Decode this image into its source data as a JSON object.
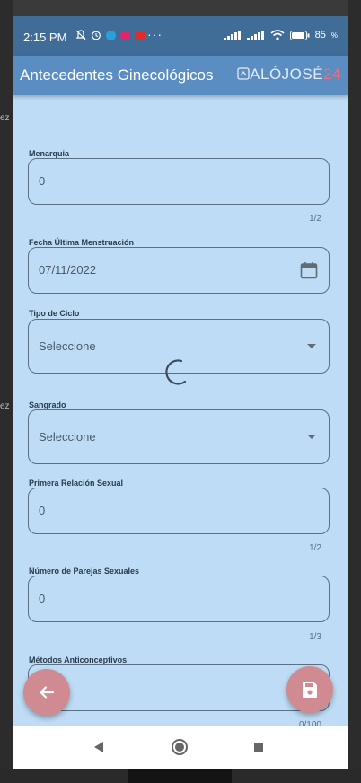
{
  "status_bar": {
    "time": "2:15 PM",
    "more": "···",
    "battery": "85"
  },
  "app_bar": {
    "title": "Antecedentes Ginecológicos",
    "logo_text": "ALÓJOSÉ",
    "logo_num": "24"
  },
  "form": {
    "menarquia": {
      "label": "Menarquia",
      "value": "0",
      "counter": "1/2"
    },
    "fum": {
      "label": "Fecha Última Menstruación",
      "value": "07/11/2022"
    },
    "tipo_ciclo": {
      "label": "Tipo de Ciclo",
      "value": "Seleccione"
    },
    "sangrado": {
      "label": "Sangrado",
      "value": "Seleccione"
    },
    "primera_relacion": {
      "label": "Primera Relación Sexual",
      "value": "0",
      "counter": "1/2"
    },
    "num_parejas": {
      "label": "Número de Parejas Sexuales",
      "value": "0",
      "counter": "1/3"
    },
    "metodos": {
      "label": "Métodos Anticonceptivos",
      "value": "",
      "counter": "0/100"
    }
  },
  "colors": {
    "status_bar": "#3f6d98",
    "app_bar": "#5a8dc2",
    "content_bg": "#bedcf5",
    "fab": "#d08b92"
  },
  "icons": {
    "back": "arrow-left-icon",
    "save": "save-icon",
    "calendar": "calendar-icon",
    "spinner": "loading-spinner"
  }
}
